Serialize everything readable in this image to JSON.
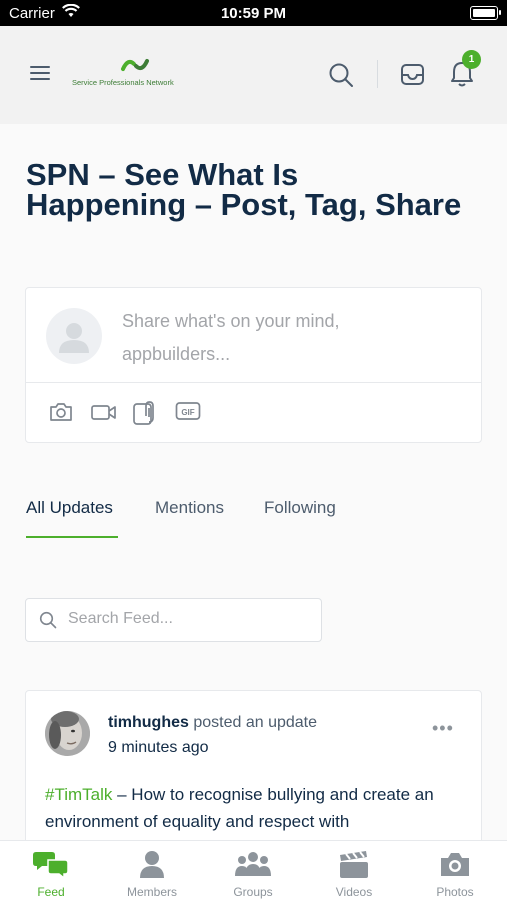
{
  "status_bar": {
    "carrier": "Carrier",
    "time": "10:59 PM"
  },
  "header": {
    "logo_text": "Service Professionals Network",
    "notification_count": "1"
  },
  "page_title": "SPN – See What Is Happening – Post, Tag, Share",
  "composer": {
    "placeholder": "Share what's on your mind, appbuilders...",
    "tools": [
      "camera-icon",
      "video-icon",
      "attachment-icon",
      "gif-icon"
    ],
    "gif_label": "GIF"
  },
  "tabs": [
    {
      "label": "All Updates",
      "active": true
    },
    {
      "label": "Mentions",
      "active": false
    },
    {
      "label": "Following",
      "active": false
    }
  ],
  "search": {
    "placeholder": "Search Feed..."
  },
  "post": {
    "author": "timhughes",
    "action": " posted an update",
    "time": "9 minutes ago",
    "more": "•••",
    "hashtag": "#TimTalk",
    "text": " – How to recognise bullying and create an environment of equality and respect with"
  },
  "bottom_nav": [
    {
      "label": "Feed",
      "icon": "chat-bubbles-icon",
      "active": true
    },
    {
      "label": "Members",
      "icon": "person-icon",
      "active": false
    },
    {
      "label": "Groups",
      "icon": "group-icon",
      "active": false
    },
    {
      "label": "Videos",
      "icon": "clapperboard-icon",
      "active": false
    },
    {
      "label": "Photos",
      "icon": "camera-icon",
      "active": false
    }
  ],
  "colors": {
    "accent": "#4caf2c",
    "text_dark": "#122b46",
    "text_muted": "#a3a5a9"
  }
}
